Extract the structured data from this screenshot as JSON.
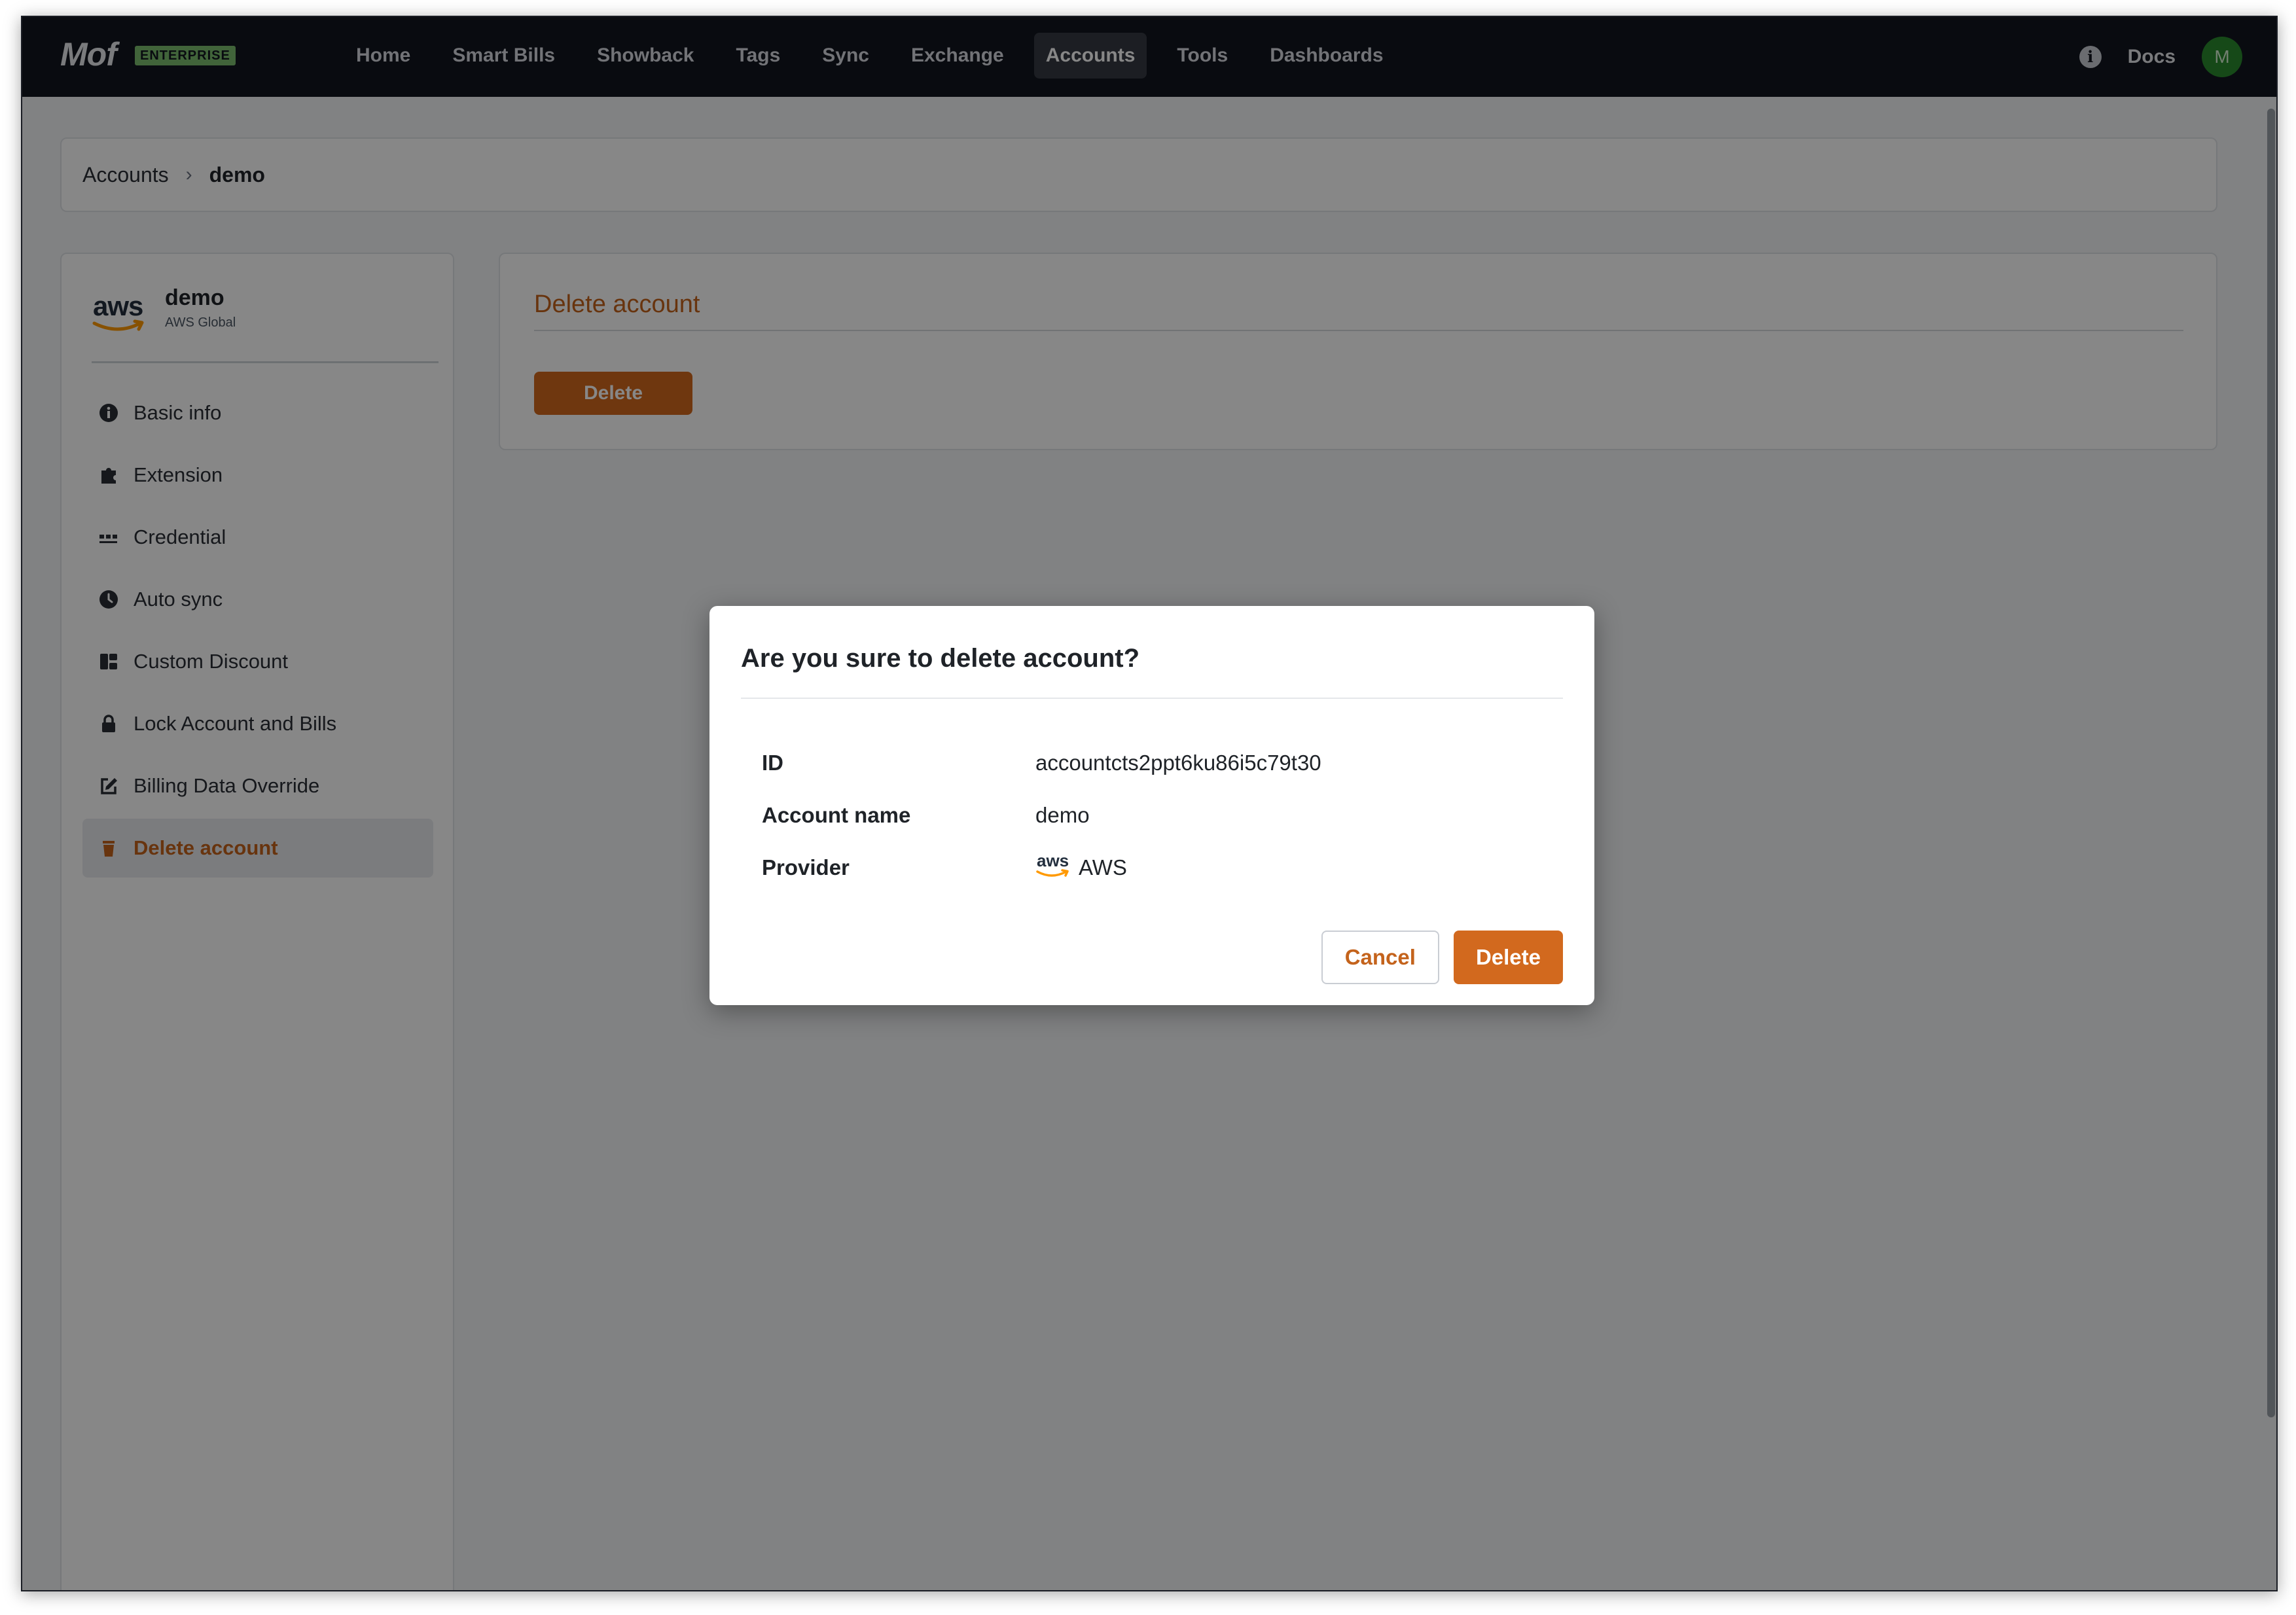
{
  "app": {
    "logo": "Mof",
    "edition": "ENTERPRISE"
  },
  "nav": {
    "items": [
      {
        "label": "Home"
      },
      {
        "label": "Smart Bills"
      },
      {
        "label": "Showback"
      },
      {
        "label": "Tags"
      },
      {
        "label": "Sync"
      },
      {
        "label": "Exchange"
      },
      {
        "label": "Accounts",
        "active": true
      },
      {
        "label": "Tools"
      },
      {
        "label": "Dashboards"
      }
    ],
    "docs": "Docs",
    "avatar": "M"
  },
  "breadcrumb": {
    "root": "Accounts",
    "separator": "›",
    "current": "demo"
  },
  "account": {
    "logo_text": "aws",
    "name": "demo",
    "region": "AWS Global"
  },
  "sidebar": {
    "items": [
      {
        "label": "Basic info",
        "icon": "info-circle-icon"
      },
      {
        "label": "Extension",
        "icon": "puzzle-icon"
      },
      {
        "label": "Credential",
        "icon": "dots-icon"
      },
      {
        "label": "Auto sync",
        "icon": "clock-icon"
      },
      {
        "label": "Custom Discount",
        "icon": "coupon-icon"
      },
      {
        "label": "Lock Account and Bills",
        "icon": "lock-icon"
      },
      {
        "label": "Billing Data Override",
        "icon": "edit-icon"
      },
      {
        "label": "Delete account",
        "icon": "trash-icon",
        "active": true
      }
    ]
  },
  "content": {
    "title": "Delete account",
    "delete_label": "Delete"
  },
  "modal": {
    "title": "Are you sure to delete account?",
    "rows": [
      {
        "key": "ID",
        "value": "accountcts2ppt6ku86i5c79t30"
      },
      {
        "key": "Account name",
        "value": "demo"
      },
      {
        "key": "Provider",
        "value": "AWS",
        "logo_text": "aws"
      }
    ],
    "cancel_label": "Cancel",
    "delete_label": "Delete"
  },
  "colors": {
    "topbar": "#12161f",
    "accent": "#d2691e",
    "accent_text": "#c4631c",
    "edition_badge": "#7bbd6e",
    "avatar": "#2a8a2e",
    "overlay": "rgba(0,0,0,0.47)"
  }
}
